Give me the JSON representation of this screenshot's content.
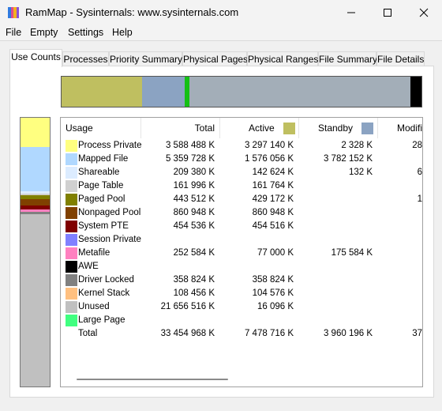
{
  "window": {
    "title": "RamMap - Sysinternals: www.sysinternals.com",
    "icon_colors": [
      "#2f7be0",
      "#e04a8a",
      "#f2b01e",
      "#8a4fd6"
    ]
  },
  "menu": [
    "File",
    "Empty",
    "Settings",
    "Help"
  ],
  "tabs": [
    "Use Counts",
    "Processes",
    "Priority Summary",
    "Physical Pages",
    "Physical Ranges",
    "File Summary",
    "File Details"
  ],
  "active_tab": "Use Counts",
  "membar_colors": [
    "#bfbf60",
    "#8ba3c2",
    "#15c015",
    "#a3aeb8",
    "#000000"
  ],
  "columns": {
    "usage": "Usage",
    "total": "Total",
    "active": "Active",
    "standby": "Standby",
    "modified": "Modifie"
  },
  "header_colors": {
    "active": "#bfbf60",
    "standby": "#8ba3c2"
  },
  "rows": [
    {
      "label": "Process Private",
      "color": "#ffff80",
      "total": "3 588 488 K",
      "active": "3 297 140 K",
      "standby": "2 328 K",
      "modified": "28"
    },
    {
      "label": "Mapped File",
      "color": "#b0d8ff",
      "total": "5 359 728 K",
      "active": "1 576 056 K",
      "standby": "3 782 152 K",
      "modified": ""
    },
    {
      "label": "Shareable",
      "color": "#dcecff",
      "total": "209 380 K",
      "active": "142 624 K",
      "standby": "132 K",
      "modified": "6"
    },
    {
      "label": "Page Table",
      "color": "#d0d0d0",
      "total": "161 996 K",
      "active": "161 764 K",
      "standby": "",
      "modified": ""
    },
    {
      "label": "Paged Pool",
      "color": "#808000",
      "total": "443 512 K",
      "active": "429 172 K",
      "standby": "",
      "modified": "1"
    },
    {
      "label": "Nonpaged Pool",
      "color": "#804000",
      "total": "860 948 K",
      "active": "860 948 K",
      "standby": "",
      "modified": ""
    },
    {
      "label": "System PTE",
      "color": "#800000",
      "total": "454 536 K",
      "active": "454 516 K",
      "standby": "",
      "modified": ""
    },
    {
      "label": "Session Private",
      "color": "#8080ff",
      "total": "",
      "active": "",
      "standby": "",
      "modified": ""
    },
    {
      "label": "Metafile",
      "color": "#ff80c0",
      "total": "252 584 K",
      "active": "77 000 K",
      "standby": "175 584 K",
      "modified": ""
    },
    {
      "label": "AWE",
      "color": "#000000",
      "total": "",
      "active": "",
      "standby": "",
      "modified": ""
    },
    {
      "label": "Driver Locked",
      "color": "#808080",
      "total": "358 824 K",
      "active": "358 824 K",
      "standby": "",
      "modified": ""
    },
    {
      "label": "Kernel Stack",
      "color": "#ffc080",
      "total": "108 456 K",
      "active": "104 576 K",
      "standby": "",
      "modified": ""
    },
    {
      "label": "Unused",
      "color": "#c0c0c0",
      "total": "21 656 516 K",
      "active": "16 096 K",
      "standby": "",
      "modified": ""
    },
    {
      "label": "Large Page",
      "color": "#40ff80",
      "total": "",
      "active": "",
      "standby": "",
      "modified": ""
    },
    {
      "label": "Total",
      "color": "",
      "total": "33 454 968 K",
      "active": "7 478 716 K",
      "standby": "3 960 196 K",
      "modified": "37"
    }
  ]
}
